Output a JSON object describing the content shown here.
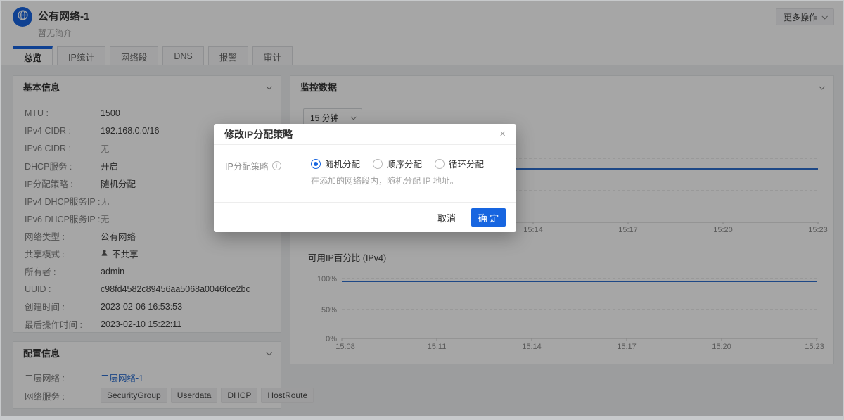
{
  "colors": {
    "primary": "#1765e0",
    "chart_line": "#2f6fce",
    "link": "#2e6fd0"
  },
  "icons": {
    "avatar": "globe-icon",
    "header_button": "chevron-down-icon",
    "panel_collapse": "chevron-down-icon",
    "share_mode": "user-icon",
    "modal_field": "info-circle-icon",
    "modal_close": "close-icon"
  },
  "header": {
    "title": "公有网络-1",
    "subtitle": "暂无简介",
    "more_button": "更多操作"
  },
  "tabs": [
    {
      "label": "总览",
      "active": true
    },
    {
      "label": "IP统计",
      "active": false
    },
    {
      "label": "网络段",
      "active": false
    },
    {
      "label": "DNS",
      "active": false
    },
    {
      "label": "报警",
      "active": false
    },
    {
      "label": "审计",
      "active": false
    }
  ],
  "basic_info": {
    "title": "基本信息",
    "rows": [
      {
        "label": "MTU :",
        "value": "1500"
      },
      {
        "label": "IPv4 CIDR :",
        "value": "192.168.0.0/16"
      },
      {
        "label": "IPv6 CIDR :",
        "value": "无",
        "muted": true
      },
      {
        "label": "DHCP服务 :",
        "value": "开启"
      },
      {
        "label": "IP分配策略 :",
        "value": "随机分配"
      },
      {
        "label": "IPv4 DHCP服务IP :",
        "value": "无",
        "muted": true
      },
      {
        "label": "IPv6 DHCP服务IP :",
        "value": "无",
        "muted": true
      },
      {
        "label": "网络类型 :",
        "value": "公有网络"
      },
      {
        "label": "共享模式 :",
        "value": "不共享",
        "icon": "user-icon"
      },
      {
        "label": "所有者 :",
        "value": "admin"
      },
      {
        "label": "UUID :",
        "value": "c98fd4582c89456aa5068a0046fce2bc"
      },
      {
        "label": "创建时间 :",
        "value": "2023-02-06 16:53:53"
      },
      {
        "label": "最后操作时间 :",
        "value": "2023-02-10 15:22:11"
      }
    ]
  },
  "config_info": {
    "title": "配置信息",
    "l2_label": "二层网络 :",
    "l2_link": "二层网络-1",
    "services_label": "网络服务 :",
    "services": [
      "SecurityGroup",
      "Userdata",
      "DHCP",
      "HostRoute"
    ]
  },
  "monitor": {
    "title": "监控数据",
    "range_selected": "15 分钟"
  },
  "chart_data": [
    {
      "type": "line",
      "title": "",
      "note": "chart mostly hidden behind dialog; only a flat horizontal line between dashed gridlines is visible",
      "x_ticks_visible": [
        "15:14",
        "15:17",
        "15:20",
        "15:23"
      ],
      "grid": "dashed horizontal",
      "legend": "none"
    },
    {
      "type": "line",
      "title": "可用IP百分比 (IPv4)",
      "x_ticks": [
        "15:08",
        "15:11",
        "15:14",
        "15:17",
        "15:20",
        "15:23"
      ],
      "y_ticks": [
        "100%",
        "50%",
        "0%"
      ],
      "ylim": [
        0,
        100
      ],
      "series": [
        {
          "name": "可用IP百分比 (IPv4)",
          "values": [
            100,
            100,
            100,
            100,
            100,
            100
          ]
        }
      ],
      "grid": "dashed horizontal",
      "legend": "none"
    }
  ],
  "modal": {
    "title": "修改IP分配策略",
    "field_label": "IP分配策略",
    "options": [
      {
        "label": "随机分配",
        "selected": true
      },
      {
        "label": "顺序分配",
        "selected": false
      },
      {
        "label": "循环分配",
        "selected": false
      }
    ],
    "helper": "在添加的网络段内，随机分配 IP 地址。",
    "cancel": "取消",
    "ok": "确 定"
  }
}
